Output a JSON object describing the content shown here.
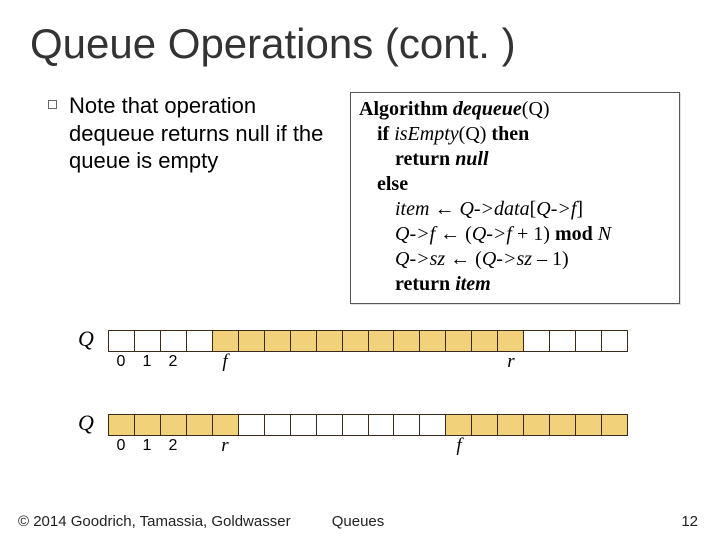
{
  "title": "Queue Operations (cont. )",
  "note": "Note that operation dequeue returns null if the queue is empty",
  "algo": {
    "keyword": "Algorithm",
    "fname": "dequeue",
    "farg": "(Q)",
    "if_kw": "if",
    "cond_fn": "isEmpty",
    "cond_arg": "(Q)",
    "then_kw": "then",
    "return_kw": "return",
    "null_kw": "null",
    "else_kw": "else",
    "item_var": "item",
    "arrow": "←",
    "q_data_open": "Q->data",
    "brL": "[",
    "qf": "Q->f",
    "brR": "]",
    "line6_lhs": "Q->f",
    "line6_rhs_open": "(",
    "line6_rhs_qf": "Q->f",
    "line6_rhs_plus": " + 1) ",
    "mod_kw": "mod",
    "N": " N",
    "line7_lhs": "Q->sz",
    "line7_rhs_open": "(",
    "line7_rhs_qsz": "Q->sz",
    "line7_rhs_tail": " – 1)",
    "return2": "return",
    "item2": "item"
  },
  "idx0": "0",
  "idx1": "1",
  "idx2": "2",
  "qlabel": "Q",
  "f_lab": "f",
  "r_lab": "r",
  "chart_data": [
    {
      "type": "table",
      "title": "Queue state (first diagram)",
      "n_cells": 20,
      "filled_range": [
        4,
        15
      ],
      "indices_shown": [
        0,
        1,
        2
      ],
      "pointers": {
        "f": 4,
        "r": 15
      }
    },
    {
      "type": "table",
      "title": "Queue state (second diagram, wraparound)",
      "n_cells": 20,
      "filled_ranges": [
        [
          0,
          4
        ],
        [
          13,
          19
        ]
      ],
      "indices_shown": [
        0,
        1,
        2
      ],
      "pointers": {
        "r": 4,
        "f": 13
      }
    }
  ],
  "footer": {
    "left": "© 2014 Goodrich, Tamassia, Goldwasser",
    "center": "Queues",
    "right": "12"
  }
}
